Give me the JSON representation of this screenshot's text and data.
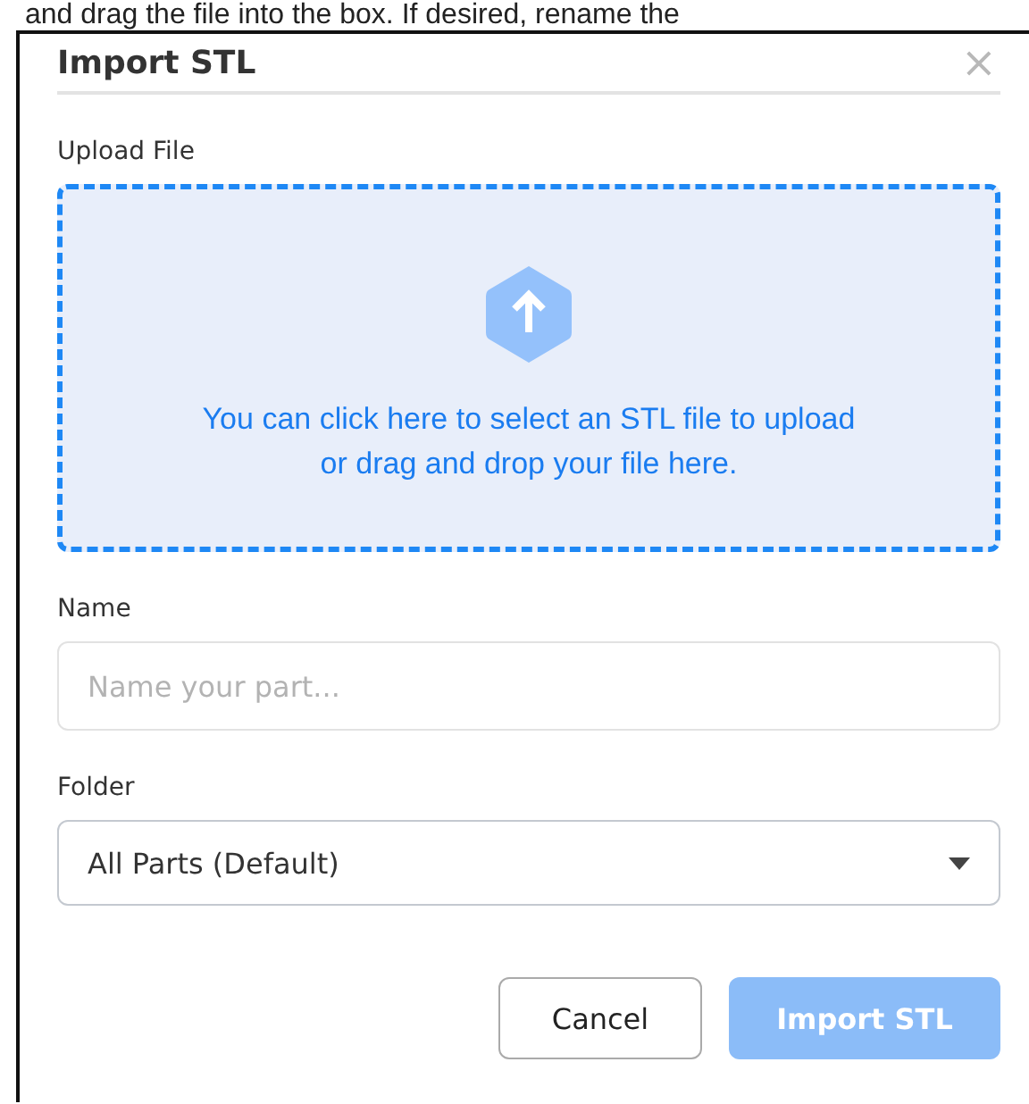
{
  "background_text": "and drag the file into the box. If desired, rename the",
  "dialog": {
    "title": "Import STL",
    "close": "×",
    "upload": {
      "label": "Upload File",
      "lines": [
        "You can click here to select an STL file to upload",
        "or drag and drop your file here."
      ]
    },
    "name_field": {
      "label": "Name",
      "placeholder": "Name your part..."
    },
    "folder_field": {
      "label": "Folder",
      "value": "All Parts (Default)"
    },
    "buttons": [
      {
        "label": "Cancel",
        "kind": "secondary",
        "disabled": false
      },
      {
        "label": "Import STL",
        "kind": "primary",
        "disabled": true
      }
    ]
  }
}
